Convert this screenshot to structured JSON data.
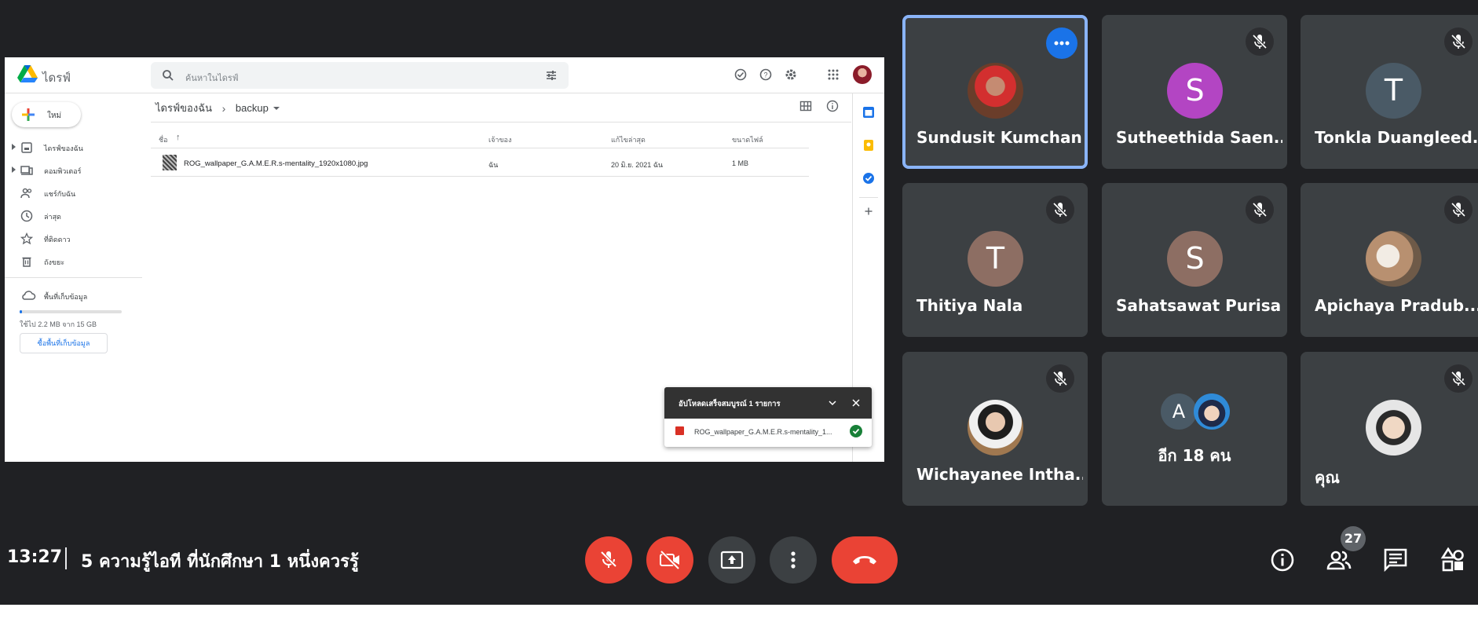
{
  "drive": {
    "app_name": "ไดรฟ์",
    "search_placeholder": "ค้นหาในไดรฟ์",
    "new_button": "ใหม่",
    "nav": [
      {
        "label": "ไดรฟ์ของฉัน",
        "icon": "my-drive-icon"
      },
      {
        "label": "คอมพิวเตอร์",
        "icon": "computers-icon"
      },
      {
        "label": "แชร์กับฉัน",
        "icon": "shared-icon"
      },
      {
        "label": "ล่าสุด",
        "icon": "recent-icon"
      },
      {
        "label": "ที่ติดดาว",
        "icon": "starred-icon"
      },
      {
        "label": "ถังขยะ",
        "icon": "trash-icon"
      }
    ],
    "storage_label": "พื้นที่เก็บข้อมูล",
    "storage_used_fraction": 0.0015,
    "storage_used_text": "ใช้ไป 2.2 MB จาก 15 GB",
    "buy_storage": "ซื้อพื้นที่เก็บข้อมูล",
    "breadcrumb": [
      "ไดรฟ์ของฉัน",
      "backup"
    ],
    "columns": [
      "ชื่อ",
      "เจ้าของ",
      "แก้ไขล่าสุด",
      "ขนาดไฟล์"
    ],
    "files": [
      {
        "name": "ROG_wallpaper_G.A.M.E.R.s-mentality_1920x1080.jpg",
        "owner": "ฉัน",
        "modified": "20 มิ.ย. 2021 ฉัน",
        "size": "1 MB"
      }
    ],
    "toast": {
      "title": "อัปโหลดเสร็จสมบูรณ์ 1 รายการ",
      "file": "ROG_wallpaper_G.A.M.E.R.s-mentality_1..."
    }
  },
  "participants": [
    {
      "name": "Sundusit Kumchan",
      "initial": "",
      "avatar_color": "#7a2f2a",
      "active": true
    },
    {
      "name": "Sutheethida Saen...",
      "initial": "S",
      "avatar_color": "#b345c3",
      "muted": true
    },
    {
      "name": "Tonkla Duangleed...",
      "initial": "T",
      "avatar_color": "#4a5a66",
      "muted": true
    },
    {
      "name": "Thitiya Nala",
      "initial": "T",
      "avatar_color": "#8d6e63",
      "muted": true
    },
    {
      "name": "Sahatsawat Purisa",
      "initial": "S",
      "avatar_color": "#8d6e63",
      "muted": true
    },
    {
      "name": "Apichaya Pradub...",
      "initial": "",
      "avatar_color": "#c9b8a0",
      "muted": true
    },
    {
      "name": "Wichayanee Intha...",
      "initial": "",
      "avatar_color": "#a07850",
      "muted": true
    },
    {
      "name": "อีก 18 คน",
      "initial": "A",
      "avatar_color": "#4a5a66",
      "muted": false,
      "group": true
    },
    {
      "name": "คุณ",
      "initial": "",
      "avatar_color": "#d8d8d8",
      "muted": true
    }
  ],
  "meeting": {
    "time": "13:27",
    "title": "5 ความรู้ไอที ที่นักศึกษา 1 หนึ่งควรรู้",
    "participant_count": "27"
  },
  "colors": {
    "background": "#202124",
    "tile": "#3c4043",
    "danger": "#ea4335",
    "active_border": "#8ab4f8",
    "drive_blue": "#1a73e8"
  }
}
